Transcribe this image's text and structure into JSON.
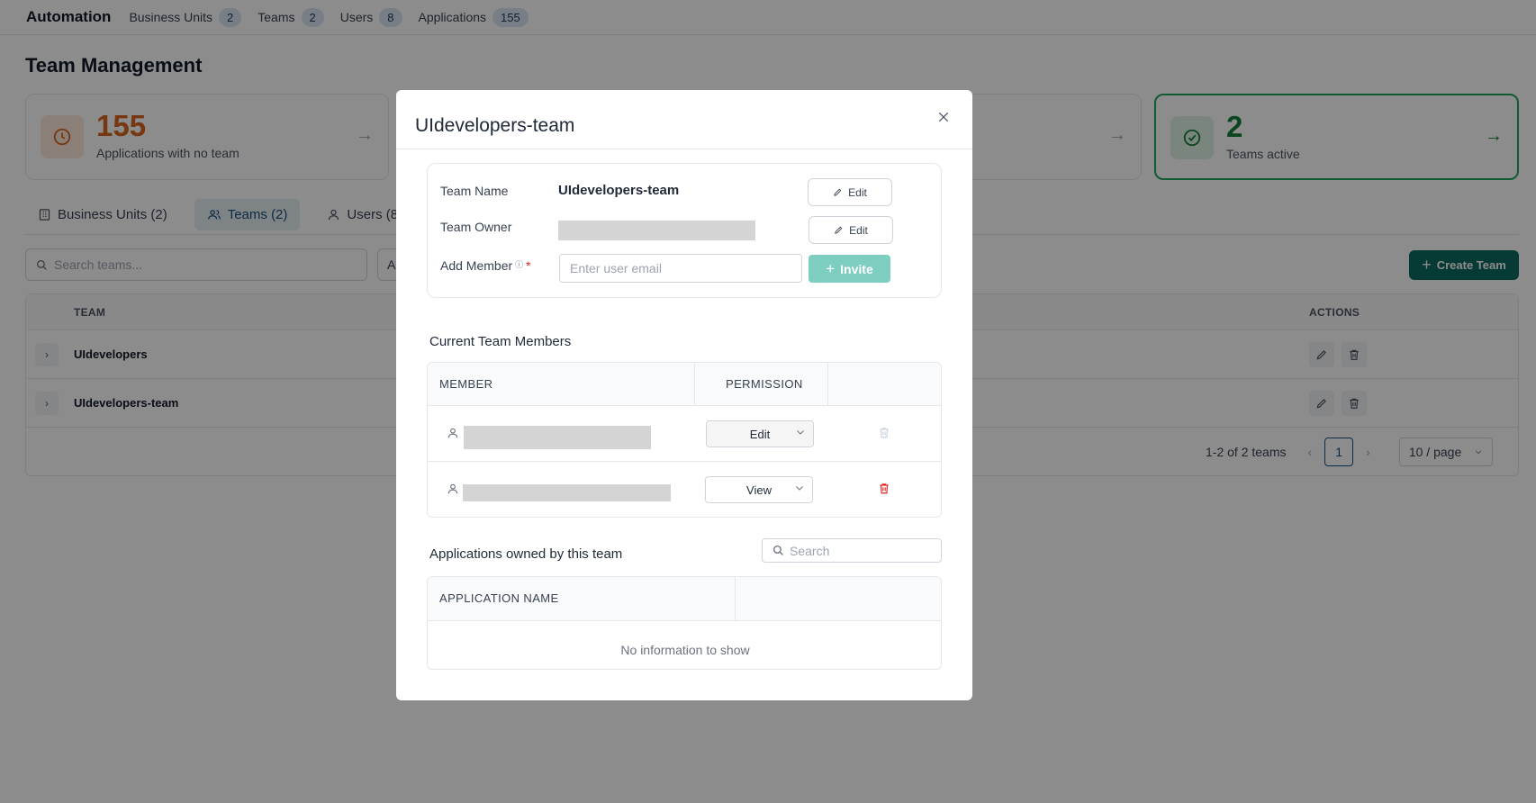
{
  "topnav": {
    "brand": "Automation",
    "items": [
      {
        "label": "Business Units",
        "count": "2"
      },
      {
        "label": "Teams",
        "count": "2"
      },
      {
        "label": "Users",
        "count": "8"
      },
      {
        "label": "Applications",
        "count": "155"
      }
    ]
  },
  "page": {
    "title": "Team Management",
    "stats": {
      "no_team": {
        "value": "155",
        "label": "Applications with no team"
      },
      "active": {
        "value": "2",
        "label": "Teams active"
      }
    },
    "tabs": [
      {
        "label": "Business Units (2)"
      },
      {
        "label": "Teams (2)"
      },
      {
        "label": "Users (8)"
      }
    ],
    "search_placeholder": "Search teams...",
    "filter_text": "A",
    "create_team_label": "Create Team",
    "table": {
      "col_team": "TEAM",
      "col_actions": "ACTIONS",
      "rows": [
        {
          "name": "UIdevelopers"
        },
        {
          "name": "UIdevelopers-team"
        }
      ]
    },
    "pagination": {
      "summary": "1-2 of 2 teams",
      "current_page": "1",
      "per_page": "10 / page"
    }
  },
  "modal": {
    "title": "UIdevelopers-team",
    "team_name_label": "Team Name",
    "team_name_value": "UIdevelopers-team",
    "team_owner_label": "Team Owner",
    "edit_label": "Edit",
    "add_member_label": "Add Member",
    "email_placeholder": "Enter user email",
    "invite_label": "Invite",
    "members_section_title": "Current Team Members",
    "members_table": {
      "col_member": "MEMBER",
      "col_permission": "PERMISSION",
      "rows": [
        {
          "permission": "Edit",
          "delete_enabled": false
        },
        {
          "permission": "View",
          "delete_enabled": true
        }
      ]
    },
    "apps_section_title": "Applications owned by this team",
    "apps_search_placeholder": "Search",
    "apps_table": {
      "col_app_name": "APPLICATION NAME",
      "empty_text": "No information to show"
    }
  },
  "colors": {
    "primary": "#0b6b61",
    "active_green": "#16803c",
    "warning_orange": "#d9661f",
    "danger_red": "#dc2626",
    "invite_disabled": "#7ecdc1"
  },
  "icons": [
    "clock-icon",
    "check-circle-icon",
    "arrow-right-icon",
    "building-icon",
    "users-icon",
    "user-icon",
    "search-icon",
    "plus-icon",
    "chevron-right-icon",
    "pencil-icon",
    "trash-icon",
    "close-icon",
    "info-icon",
    "chevron-down-icon",
    "chevron-left-icon"
  ]
}
